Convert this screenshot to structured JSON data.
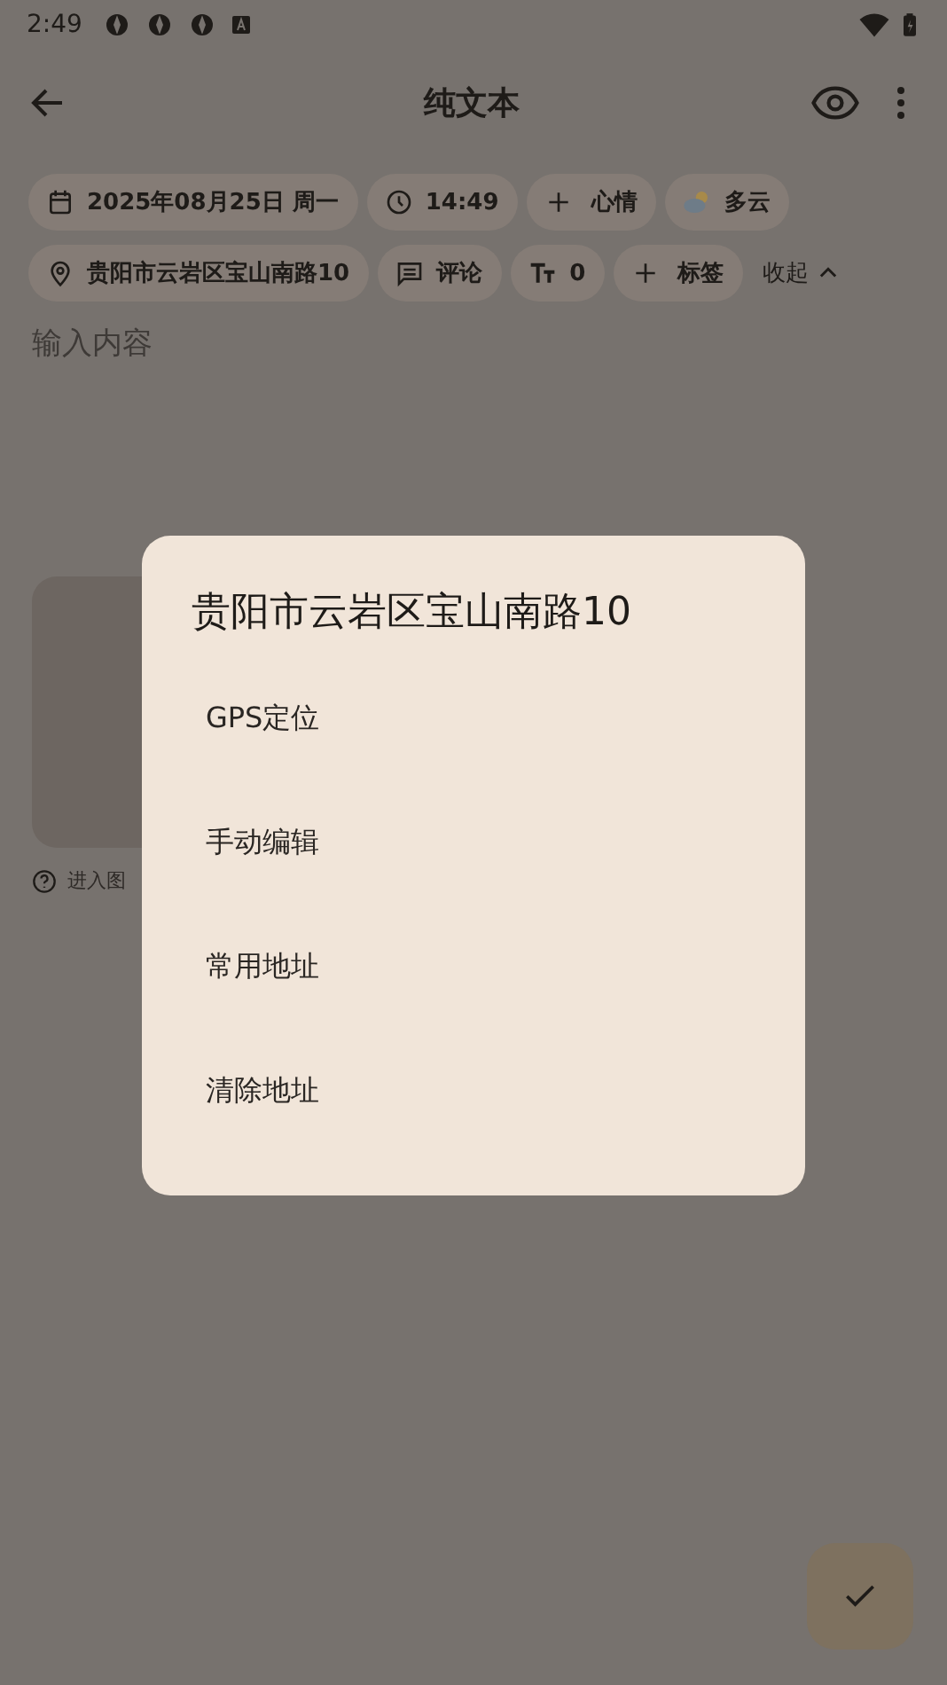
{
  "status_bar": {
    "time": "2:49"
  },
  "top_bar": {
    "title": "纯文本"
  },
  "chips": [
    {
      "kind": "date",
      "label": "2025年08月25日 周一"
    },
    {
      "kind": "time",
      "label": "14:49"
    },
    {
      "kind": "add",
      "label": "心情"
    },
    {
      "kind": "weather",
      "label": "多云"
    },
    {
      "kind": "location",
      "label": "贵阳市云岩区宝山南路10"
    },
    {
      "kind": "comment",
      "label": "评论"
    },
    {
      "kind": "textsize",
      "label": "0"
    },
    {
      "kind": "add",
      "label": "标签"
    }
  ],
  "collapse": {
    "label": "收起"
  },
  "editor": {
    "placeholder": "输入内容"
  },
  "image_hint": "进入图",
  "dialog": {
    "title": "贵阳市云岩区宝山南路10",
    "options": [
      "GPS定位",
      "手动编辑",
      "常用地址",
      "清除地址"
    ]
  }
}
